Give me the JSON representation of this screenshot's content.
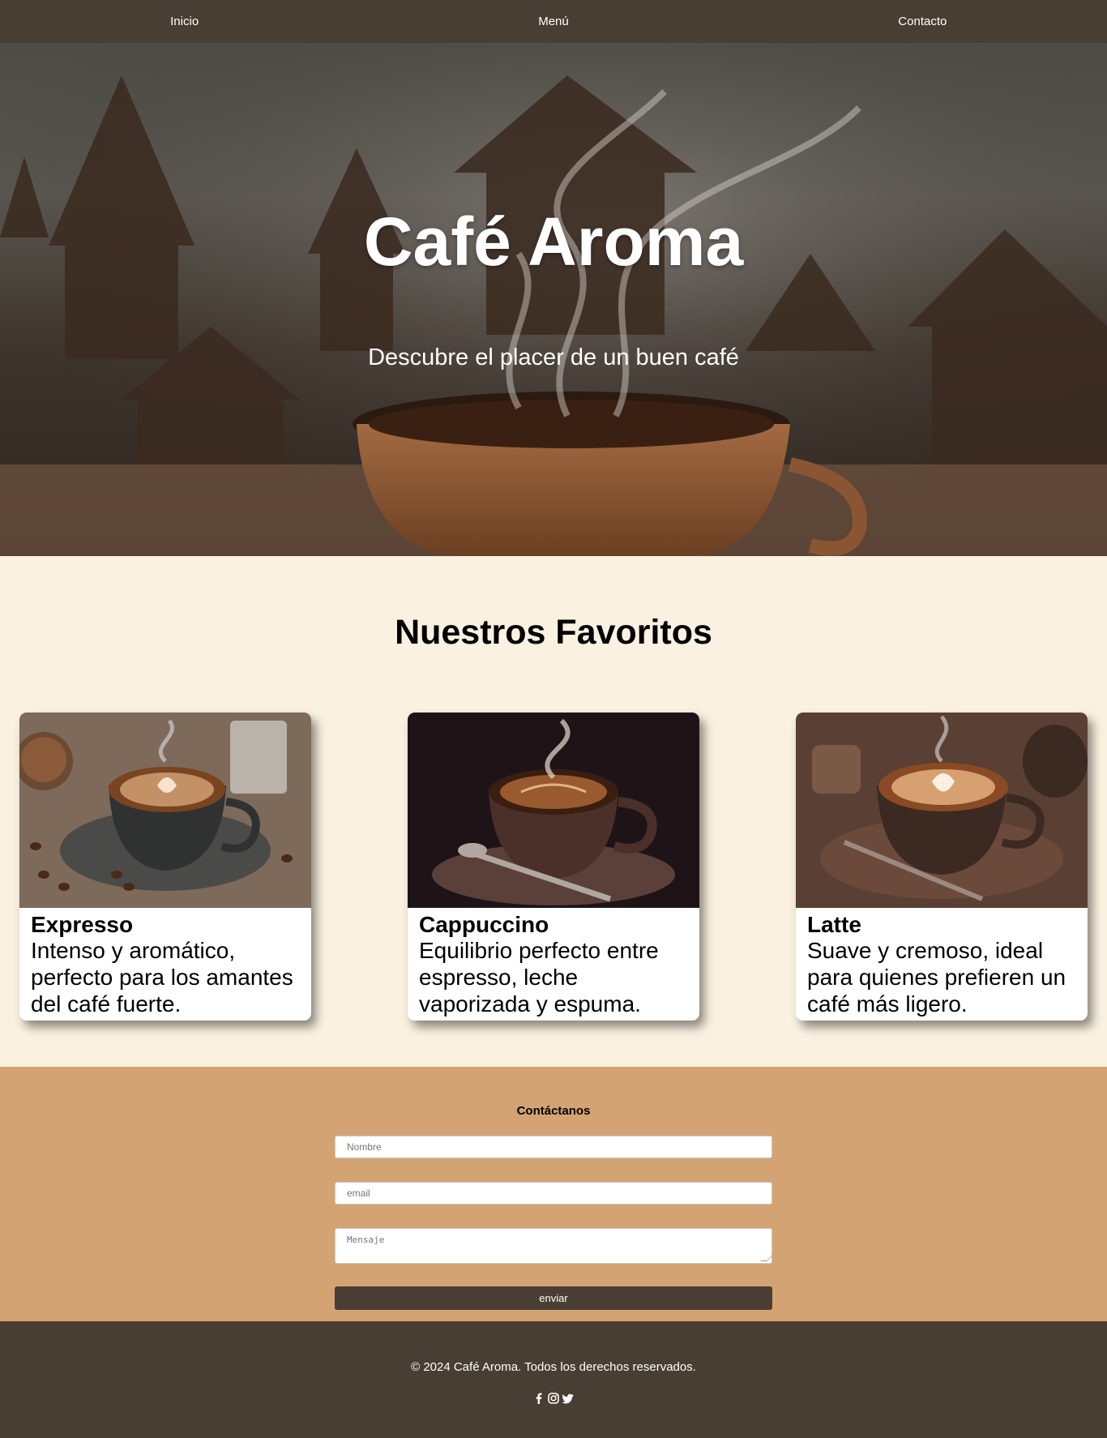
{
  "nav": {
    "items": [
      {
        "label": "Inicio"
      },
      {
        "label": "Menú"
      },
      {
        "label": "Contacto"
      }
    ]
  },
  "hero": {
    "title": "Café Aroma",
    "subtitle": "Descubre el placer de un buen café"
  },
  "favorites": {
    "title": "Nuestros Favoritos",
    "cards": [
      {
        "name": "Expresso",
        "description": "Intenso y aromático, perfecto para los amantes del café fuerte."
      },
      {
        "name": "Cappuccino",
        "description": "Equilibrio perfecto entre espresso, leche vaporizada y espuma."
      },
      {
        "name": "Latte",
        "description": "Suave y cremoso, ideal para quienes prefieren un café más ligero."
      }
    ]
  },
  "contact": {
    "title": "Contáctanos",
    "name_placeholder": "Nombre",
    "email_placeholder": "email",
    "message_placeholder": "Mensaje",
    "submit_label": "enviar"
  },
  "footer": {
    "copyright": "© 2024 Café Aroma. Todos los derechos reservados.",
    "socials": [
      "facebook-icon",
      "instagram-icon",
      "twitter-icon"
    ]
  },
  "colors": {
    "nav_bg": "#493e33",
    "body_bg": "#faf1e0",
    "contact_bg": "#d4a373",
    "button_bg": "#493e33"
  }
}
